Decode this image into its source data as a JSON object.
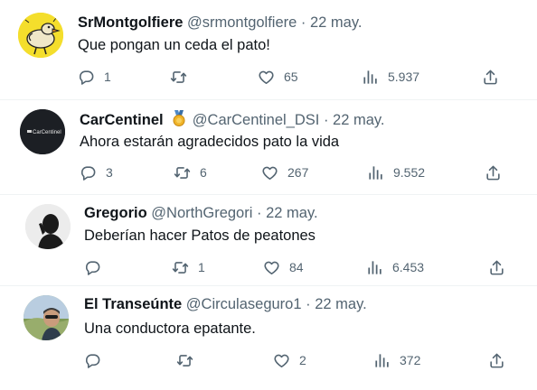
{
  "tweets": [
    {
      "name": "SrMontgolfiere",
      "handle": "@srmontgolfiere",
      "sep": "·",
      "date": "22 may.",
      "text": "Que pongan un ceda el pato!",
      "replies": "1",
      "retweets": "",
      "likes": "65",
      "views": "5.937"
    },
    {
      "name": "CarCentinel",
      "handle": "@CarCentinel_DSI",
      "sep": "·",
      "date": "22 may.",
      "text": "Ahora estarán agradecidos pato la vida",
      "avatar_text": "CarCentinel",
      "replies": "3",
      "retweets": "6",
      "likes": "267",
      "views": "9.552"
    },
    {
      "name": "Gregorio",
      "handle": "@NorthGregori",
      "sep": "·",
      "date": "22 may.",
      "text": "Deberían hacer Patos de peatones",
      "replies": "",
      "retweets": "1",
      "likes": "84",
      "views": "6.453"
    },
    {
      "name": "El Transeúnte",
      "handle": "@Circulaseguro1",
      "sep": "·",
      "date": "22 may.",
      "text": "Una conductora epatante.",
      "replies": "",
      "retweets": "",
      "likes": "2",
      "views": "372"
    }
  ],
  "icons": {
    "reply": "reply-icon",
    "retweet": "retweet-icon",
    "like": "heart-icon",
    "views": "views-icon",
    "share": "share-icon",
    "badge": "medal-badge-icon"
  },
  "colors": {
    "text": "#0f1419",
    "secondary": "#536471",
    "divider": "#eff3f4",
    "avatar1_bg": "#f2dc2a",
    "avatar2_bg": "#1c1f24"
  }
}
